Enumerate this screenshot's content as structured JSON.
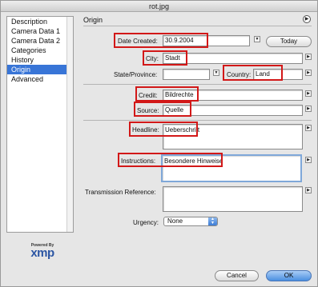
{
  "window": {
    "title": "rot.jpg"
  },
  "sidebar": {
    "items": [
      {
        "label": "Description"
      },
      {
        "label": "Camera Data 1"
      },
      {
        "label": "Camera Data 2"
      },
      {
        "label": "Categories"
      },
      {
        "label": "History"
      },
      {
        "label": "Origin"
      },
      {
        "label": "Advanced"
      }
    ],
    "selected": "Origin"
  },
  "logo": {
    "powered_by": "Powered By",
    "name": "xmp"
  },
  "panel": {
    "title": "Origin",
    "date_created": {
      "label": "Date Created:",
      "value": "30.9.2004",
      "today_button": "Today"
    },
    "city": {
      "label": "City:",
      "value": "Stadt"
    },
    "state": {
      "label": "State/Province:",
      "value": ""
    },
    "country": {
      "label": "Country:",
      "value": "Land"
    },
    "credit": {
      "label": "Credit:",
      "value": "Bildrechte"
    },
    "source": {
      "label": "Source:",
      "value": "Quelle"
    },
    "headline": {
      "label": "Headline:",
      "value": "Ueberschrift"
    },
    "instructions": {
      "label": "Instructions:",
      "value": "Besondere Hinweise"
    },
    "transmission": {
      "label": "Transmission Reference:",
      "value": ""
    },
    "urgency": {
      "label": "Urgency:",
      "value": "None"
    }
  },
  "buttons": {
    "cancel": "Cancel",
    "ok": "OK"
  },
  "colors": {
    "highlight": "#d21818",
    "selection": "#3875d7",
    "default_button": "#4a8fe0"
  }
}
